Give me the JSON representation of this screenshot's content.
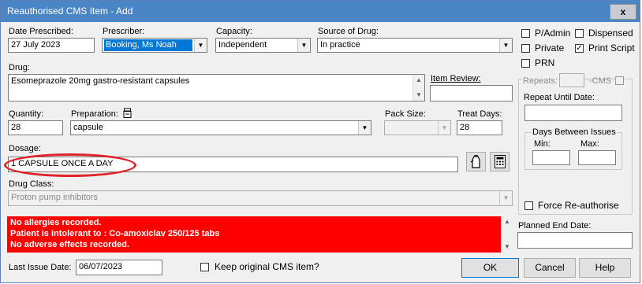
{
  "window": {
    "title": "Reauthorised CMS Item - Add",
    "close_label": "x"
  },
  "date_prescribed": {
    "label": "Date Prescribed:",
    "value": "27 July 2023"
  },
  "prescriber": {
    "label": "Prescriber:",
    "value": "Booking, Ms Noah"
  },
  "capacity": {
    "label": "Capacity:",
    "value": "Independent"
  },
  "source_of_drug": {
    "label": "Source of Drug:",
    "value": "In practice"
  },
  "options": {
    "p_admin": {
      "label": "P/Admin",
      "checked": false
    },
    "dispensed": {
      "label": "Dispensed",
      "checked": false
    },
    "private": {
      "label": "Private",
      "checked": false
    },
    "print_script": {
      "label": "Print Script",
      "checked": true
    },
    "prn": {
      "label": "PRN",
      "checked": false
    }
  },
  "drug": {
    "label": "Drug:",
    "value": "Esomeprazole 20mg gastro-resistant capsules"
  },
  "item_review": {
    "label": "Item Review:",
    "value": ""
  },
  "repeats": {
    "label": "Repeats:",
    "value": "",
    "cms_label": "CMS"
  },
  "repeat_until": {
    "label": "Repeat Until Date:",
    "value": ""
  },
  "days_between": {
    "label": "Days Between Issues",
    "min_label": "Min:",
    "max_label": "Max:"
  },
  "quantity": {
    "label": "Quantity:",
    "value": "28"
  },
  "preparation": {
    "label": "Preparation:",
    "value": "capsule"
  },
  "pack_size": {
    "label": "Pack Size:",
    "value": ""
  },
  "treat_days": {
    "label": "Treat Days:",
    "value": "28"
  },
  "dosage": {
    "label": "Dosage:",
    "value": "1 CAPSULE ONCE A DAY"
  },
  "drug_class": {
    "label": "Drug Class:",
    "value": "Proton pump inhibitors"
  },
  "force_reauthorise": {
    "label": "Force Re-authorise",
    "checked": false
  },
  "alerts": [
    "No allergies recorded.",
    "Patient is intolerant to : Co-amoxiclav 250/125 tabs",
    "No adverse effects recorded."
  ],
  "planned_end_date": {
    "label": "Planned End Date:",
    "value": ""
  },
  "last_issue_date": {
    "label": "Last Issue Date:",
    "value": "06/07/2023"
  },
  "keep_original": {
    "label": "Keep original CMS item?",
    "checked": false
  },
  "buttons": {
    "ok": "OK",
    "cancel": "Cancel",
    "help": "Help"
  },
  "annotation_color": "#e0242a",
  "alert_color": "#ff0000"
}
